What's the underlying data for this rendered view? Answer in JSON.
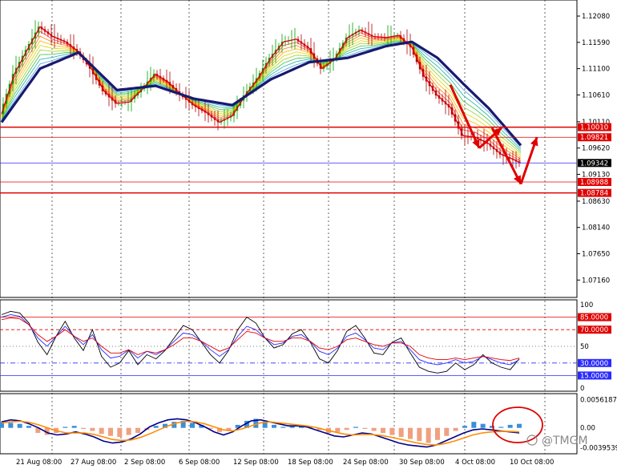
{
  "chart_data": [
    {
      "type": "line",
      "panel": "price",
      "instrument_hint": "EURUSD style forex candlestick chart with moving average ribbon",
      "x_labels": [
        "21 Aug 08:00",
        "27 Aug 08:00",
        "2 Sep 08:00",
        "6 Sep 08:00",
        "12 Sep 08:00",
        "18 Sep 08:00",
        "24 Sep 08:00",
        "30 Sep 08:00",
        "4 Oct 08:00",
        "10 Oct 08:00"
      ],
      "y_ticks": [
        "1.12080",
        "1.11590",
        "1.11100",
        "1.10610",
        "1.10110",
        "1.09620",
        "1.09130",
        "1.08630",
        "1.08140",
        "1.07650",
        "1.07160"
      ],
      "ylim": [
        1.0703,
        1.1223
      ],
      "price_path": [
        [
          0,
          1.1026
        ],
        [
          2,
          1.11
        ],
        [
          4,
          1.1145
        ],
        [
          6,
          1.1188
        ],
        [
          8,
          1.117
        ],
        [
          10,
          1.116
        ],
        [
          12,
          1.1142
        ],
        [
          14,
          1.111
        ],
        [
          16,
          1.1068
        ],
        [
          18,
          1.1045
        ],
        [
          20,
          1.1048
        ],
        [
          22,
          1.1072
        ],
        [
          24,
          1.11
        ],
        [
          26,
          1.1085
        ],
        [
          28,
          1.1062
        ],
        [
          30,
          1.1042
        ],
        [
          32,
          1.1028
        ],
        [
          34,
          1.101
        ],
        [
          36,
          1.1022
        ],
        [
          38,
          1.106
        ],
        [
          40,
          1.1092
        ],
        [
          42,
          1.113
        ],
        [
          44,
          1.116
        ],
        [
          46,
          1.1165
        ],
        [
          48,
          1.1148
        ],
        [
          50,
          1.111
        ],
        [
          52,
          1.1128
        ],
        [
          54,
          1.1168
        ],
        [
          56,
          1.1182
        ],
        [
          58,
          1.117
        ],
        [
          60,
          1.1168
        ],
        [
          62,
          1.1172
        ],
        [
          64,
          1.115
        ],
        [
          66,
          1.1095
        ],
        [
          68,
          1.106
        ],
        [
          70,
          1.1038
        ],
        [
          72,
          1.0985
        ],
        [
          74,
          1.0982
        ],
        [
          76,
          1.097
        ],
        [
          78,
          1.095
        ],
        [
          80,
          1.094
        ],
        [
          81,
          1.0934
        ]
      ],
      "ma_thick": [
        [
          0,
          1.101
        ],
        [
          6,
          1.111
        ],
        [
          12,
          1.114
        ],
        [
          18,
          1.107
        ],
        [
          24,
          1.1078
        ],
        [
          30,
          1.1054
        ],
        [
          36,
          1.1042
        ],
        [
          42,
          1.109
        ],
        [
          48,
          1.1122
        ],
        [
          54,
          1.113
        ],
        [
          60,
          1.1152
        ],
        [
          64,
          1.116
        ],
        [
          68,
          1.113
        ],
        [
          72,
          1.1082
        ],
        [
          76,
          1.1036
        ],
        [
          81,
          1.0967
        ]
      ],
      "horizontal_levels": [
        {
          "value": 1.1001,
          "label": "1.10010",
          "color": "#e00000",
          "width": 1.5
        },
        {
          "value": 1.09821,
          "label": "1.09821",
          "color": "#e00000",
          "width": 0.8
        },
        {
          "value": 1.09342,
          "label": "1.09342",
          "color": "#2a2aff",
          "width": 0.8,
          "current": true
        },
        {
          "value": 1.08988,
          "label": "1.08988",
          "color": "#e00000",
          "width": 0.8
        },
        {
          "value": 1.08784,
          "label": "1.08784",
          "color": "#e00000",
          "width": 1.5
        }
      ],
      "arrows_hint": "red forecast arrows: down to ~1.0965, up to ~1.1000, down to ~1.0895, up toward ~1.0980"
    },
    {
      "type": "line",
      "panel": "oscillator",
      "ylim": [
        0,
        100
      ],
      "y_ticks": [
        "100",
        "85.0000",
        "70.0000",
        "50",
        "30.0000",
        "15.0000",
        "0"
      ],
      "levels": [
        {
          "value": 85,
          "label": "85.0000",
          "color": "#e00000",
          "style": "solid"
        },
        {
          "value": 70,
          "label": "70.0000",
          "color": "#e00000",
          "style": "dash"
        },
        {
          "value": 50,
          "label": "50",
          "color": "#555555",
          "style": "dot"
        },
        {
          "value": 30,
          "label": "30.0000",
          "color": "#2a2aff",
          "style": "dashdot"
        },
        {
          "value": 15,
          "label": "15.0000",
          "color": "#2a2aff",
          "style": "solid"
        }
      ],
      "series": [
        {
          "color": "#000000",
          "values": [
            88,
            92,
            90,
            78,
            55,
            40,
            62,
            80,
            60,
            45,
            70,
            38,
            25,
            30,
            45,
            28,
            40,
            35,
            45,
            60,
            75,
            70,
            55,
            40,
            30,
            45,
            70,
            85,
            78,
            60,
            48,
            52,
            65,
            70,
            55,
            35,
            30,
            45,
            68,
            75,
            60,
            42,
            40,
            55,
            60,
            42,
            25,
            20,
            18,
            20,
            30,
            22,
            28,
            40,
            30,
            25,
            22,
            35
          ]
        },
        {
          "color": "#2a2aff",
          "values": [
            85,
            88,
            86,
            76,
            60,
            50,
            62,
            74,
            62,
            52,
            64,
            46,
            36,
            38,
            46,
            36,
            44,
            40,
            46,
            56,
            66,
            64,
            56,
            46,
            38,
            46,
            62,
            74,
            70,
            60,
            52,
            54,
            62,
            64,
            56,
            44,
            40,
            48,
            62,
            66,
            58,
            48,
            46,
            54,
            56,
            46,
            34,
            30,
            28,
            30,
            34,
            30,
            32,
            38,
            34,
            30,
            28,
            34
          ]
        },
        {
          "color": "#e00000",
          "values": [
            82,
            84,
            83,
            76,
            64,
            56,
            62,
            70,
            62,
            56,
            60,
            50,
            42,
            42,
            46,
            40,
            44,
            42,
            46,
            52,
            60,
            60,
            56,
            50,
            44,
            48,
            58,
            68,
            66,
            60,
            56,
            56,
            60,
            60,
            56,
            48,
            46,
            50,
            58,
            60,
            56,
            52,
            50,
            54,
            54,
            50,
            40,
            36,
            34,
            34,
            36,
            34,
            36,
            38,
            36,
            34,
            33,
            36
          ]
        }
      ]
    },
    {
      "type": "bar",
      "panel": "macd_histogram",
      "y_ticks": [
        "0.00561870",
        "0.00",
        "-0.00395390"
      ],
      "ylim": [
        -0.0045,
        0.006
      ],
      "histogram": [
        0.0012,
        0.001,
        0.0008,
        0.0004,
        -0.001,
        -0.0014,
        -0.001,
        0.0002,
        0.0004,
        -0.0002,
        -0.0006,
        -0.0012,
        -0.0016,
        -0.0018,
        -0.0014,
        -0.001,
        -0.0004,
        0.0004,
        0.0008,
        0.0012,
        0.0014,
        0.001,
        0.0006,
        -0.0002,
        -0.0008,
        -0.0006,
        0.0006,
        0.0014,
        0.0018,
        0.0012,
        0.0006,
        0.0002,
        0.0004,
        0.0006,
        0.0002,
        -0.0004,
        -0.001,
        -0.0008,
        -0.0004,
        0.0002,
        -0.0002,
        -0.0006,
        -0.001,
        -0.0014,
        -0.0018,
        -0.0022,
        -0.0026,
        -0.003,
        -0.0024,
        -0.0016,
        -0.0006,
        0.0004,
        0.0012,
        0.0008,
        0.0004,
        0.0002,
        0.0006,
        0.0008
      ],
      "series": [
        {
          "color": "#00008b",
          "values": [
            0.0012,
            0.0016,
            0.0014,
            0.0008,
            0.0,
            -0.001,
            -0.0014,
            -0.0012,
            -0.0008,
            -0.0012,
            -0.0018,
            -0.0026,
            -0.003,
            -0.0028,
            -0.0022,
            -0.0012,
            0.0002,
            0.001,
            0.0016,
            0.0018,
            0.0016,
            0.001,
            0.0002,
            -0.0008,
            -0.0014,
            -0.0008,
            0.0004,
            0.0014,
            0.0016,
            0.0012,
            0.0008,
            0.0004,
            0.0004,
            0.0002,
            -0.0004,
            -0.001,
            -0.0016,
            -0.0018,
            -0.0014,
            -0.001,
            -0.0012,
            -0.0018,
            -0.0024,
            -0.003,
            -0.0034,
            -0.0036,
            -0.0038,
            -0.0034,
            -0.0026,
            -0.0018,
            -0.001,
            -0.0004,
            -0.0002,
            -0.0004,
            -0.0006,
            -0.0008,
            -0.001
          ]
        },
        {
          "color": "#ff8c00",
          "values": [
            0.001,
            0.0012,
            0.0013,
            0.0011,
            0.0006,
            0.0,
            -0.0006,
            -0.001,
            -0.001,
            -0.001,
            -0.0013,
            -0.0018,
            -0.0023,
            -0.0025,
            -0.0024,
            -0.0019,
            -0.0012,
            -0.0004,
            0.0004,
            0.001,
            0.0013,
            0.0012,
            0.0008,
            0.0002,
            -0.0004,
            -0.0006,
            -0.0002,
            0.0004,
            0.001,
            0.0012,
            0.001,
            0.0008,
            0.0006,
            0.0004,
            0.0001,
            -0.0004,
            -0.0008,
            -0.0012,
            -0.0014,
            -0.0013,
            -0.0013,
            -0.0015,
            -0.0018,
            -0.0022,
            -0.0026,
            -0.003,
            -0.0033,
            -0.0034,
            -0.0031,
            -0.0026,
            -0.002,
            -0.0014,
            -0.001,
            -0.0008,
            -0.0007,
            -0.0007,
            -0.0008
          ]
        }
      ]
    }
  ],
  "watermark": "@TMGM",
  "colors": {
    "price_line": "#e00000",
    "ma": "#191970",
    "candle_up": "#00a000",
    "candle_dn": "#b00000",
    "hist_pos": "#3a8fd8",
    "hist_neg": "#f0a080",
    "circle": "#e00000"
  }
}
